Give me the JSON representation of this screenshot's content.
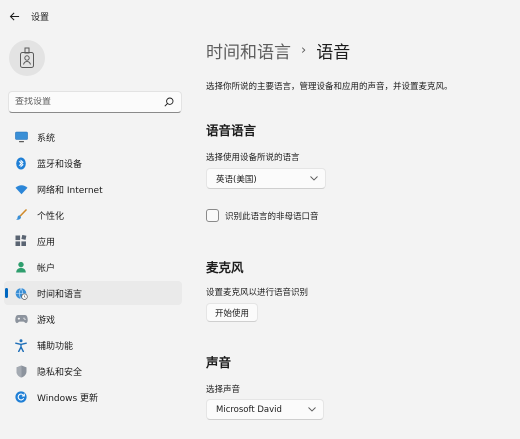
{
  "window": {
    "title": "设置"
  },
  "search": {
    "placeholder": "查找设置"
  },
  "sidebar": {
    "items": [
      {
        "label": "系统",
        "icon": "monitor-icon",
        "active": false
      },
      {
        "label": "蓝牙和设备",
        "icon": "bluetooth-icon",
        "active": false
      },
      {
        "label": "网络和 Internet",
        "icon": "wifi-icon",
        "active": false
      },
      {
        "label": "个性化",
        "icon": "brush-icon",
        "active": false
      },
      {
        "label": "应用",
        "icon": "apps-icon",
        "active": false
      },
      {
        "label": "帐户",
        "icon": "person-icon",
        "active": false
      },
      {
        "label": "时间和语言",
        "icon": "globe-clock-icon",
        "active": true
      },
      {
        "label": "游戏",
        "icon": "gamepad-icon",
        "active": false
      },
      {
        "label": "辅助功能",
        "icon": "accessibility-icon",
        "active": false
      },
      {
        "label": "隐私和安全",
        "icon": "shield-icon",
        "active": false
      },
      {
        "label": "Windows 更新",
        "icon": "update-icon",
        "active": false
      }
    ]
  },
  "header": {
    "parent": "时间和语言",
    "separator": "›",
    "current": "语音"
  },
  "main": {
    "description": "选择你所说的主要语言，管理设备和应用的声音，并设置麦克风。",
    "speech_language": {
      "title": "语音语言",
      "label": "选择使用设备所说的语言",
      "selected": "英语(美国)",
      "checkbox_label": "识别此语言的非母语口音",
      "checkbox_checked": false
    },
    "microphone": {
      "title": "麦克风",
      "label": "设置麦克风以进行语音识别",
      "button_label": "开始使用"
    },
    "voice": {
      "title": "声音",
      "label": "选择声音",
      "selected": "Microsoft David"
    }
  },
  "colors": {
    "accent": "#0067c0",
    "background": "#f3f3f3",
    "active_item": "#eaeaea"
  }
}
